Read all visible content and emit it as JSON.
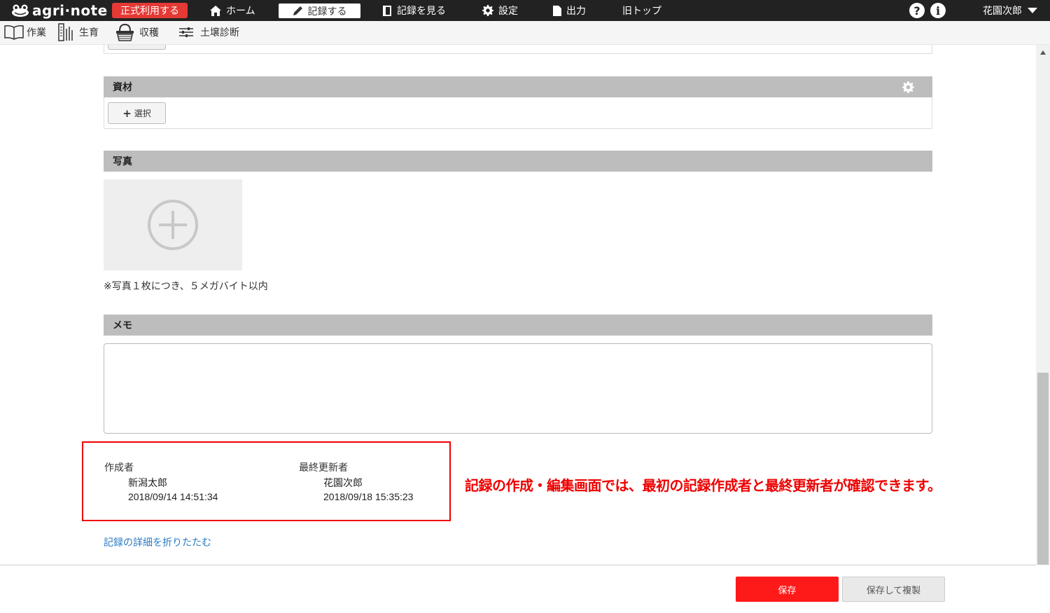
{
  "header": {
    "logo_text": "agri·note",
    "official_label": "正式利用する",
    "nav": {
      "home": "ホーム",
      "record": "記録する",
      "view": "記録を見る",
      "settings": "設定",
      "output": "出力",
      "old_top": "旧トップ"
    },
    "help_icon": "?",
    "info_icon": "i",
    "user_name": "花園次郎"
  },
  "subnav": {
    "work": "作業",
    "growth": "生育",
    "harvest": "収穫",
    "soil": "土壌診断"
  },
  "materials": {
    "title": "資材",
    "select_label": "選択"
  },
  "photo": {
    "title": "写真",
    "note": "※写真１枚につき、５メガバイト以内"
  },
  "memo": {
    "title": "メモ",
    "value": ""
  },
  "audit": {
    "creator_label": "作成者",
    "creator_name": "新潟太郎",
    "created_at": "2018/09/14 14:51:34",
    "updater_label": "最終更新者",
    "updater_name": "花園次郎",
    "updated_at": "2018/09/18 15:35:23"
  },
  "annotation": "記録の作成・編集画面では、最初の記録作成者と最終更新者が確認できます。",
  "collapse_link": "記録の詳細を折りたたむ",
  "footer": {
    "save": "保存",
    "save_copy": "保存して複製"
  },
  "colors": {
    "topbar": "#222222",
    "accent_red": "#e53935",
    "save_red": "#ff1a1a",
    "section_gray": "#bdbdbd",
    "link_blue": "#2a7bc4"
  }
}
